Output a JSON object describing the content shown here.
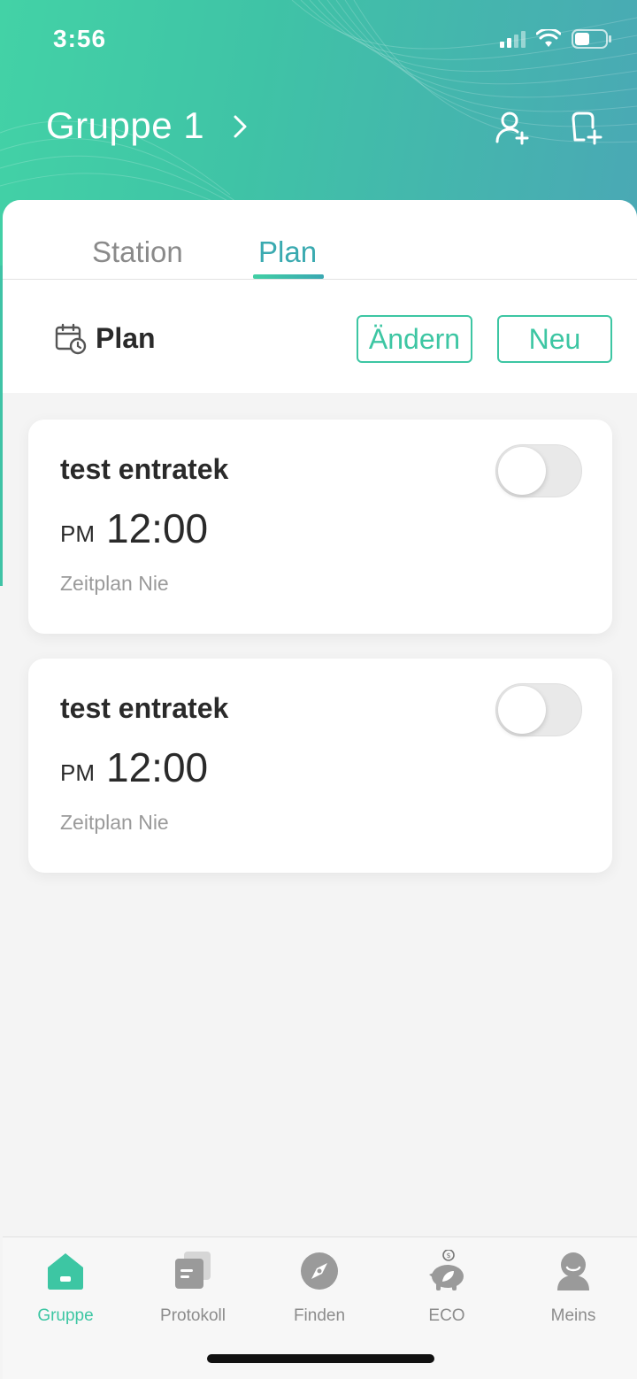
{
  "status": {
    "time": "3:56"
  },
  "header": {
    "title": "Gruppe 1"
  },
  "tabs": [
    {
      "label": "Station",
      "active": false
    },
    {
      "label": "Plan",
      "active": true
    }
  ],
  "plan_bar": {
    "label": "Plan",
    "edit_label": "Ändern",
    "new_label": "Neu"
  },
  "schedules": [
    {
      "name": "test entratek",
      "ampm": "PM",
      "time": "12:00",
      "repeat": "Zeitplan Nie",
      "enabled": false
    },
    {
      "name": "test entratek",
      "ampm": "PM",
      "time": "12:00",
      "repeat": "Zeitplan Nie",
      "enabled": false
    }
  ],
  "bottom_nav": [
    {
      "label": "Gruppe",
      "icon": "home-icon",
      "active": true
    },
    {
      "label": "Protokoll",
      "icon": "log-icon",
      "active": false
    },
    {
      "label": "Finden",
      "icon": "compass-icon",
      "active": false
    },
    {
      "label": "ECO",
      "icon": "piggy-bank-icon",
      "active": false
    },
    {
      "label": "Meins",
      "icon": "profile-icon",
      "active": false
    }
  ],
  "colors": {
    "accent": "#3dc6a3",
    "header_start": "#43d2a6",
    "header_end": "#4aa8b5",
    "tab_active": "#3aaab0"
  }
}
